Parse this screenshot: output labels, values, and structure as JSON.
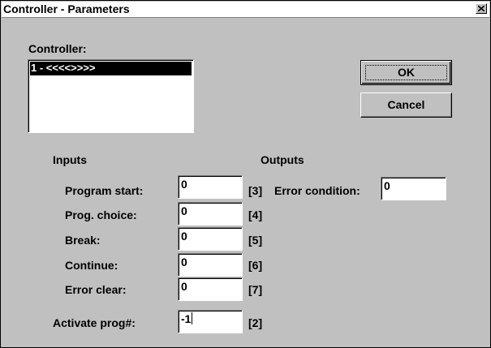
{
  "window": {
    "title": "Controller - Parameters",
    "close_icon": "close-icon"
  },
  "controller": {
    "label": "Controller:",
    "items": [
      "1 - <<<<>>>>"
    ],
    "selected_index": 0
  },
  "buttons": {
    "ok_label": "OK",
    "cancel_label": "Cancel"
  },
  "inputs": {
    "heading": "Inputs",
    "fields": [
      {
        "label": "Program start:",
        "value": "0",
        "index": "[3]"
      },
      {
        "label": "Prog. choice:",
        "value": "0",
        "index": "[4]"
      },
      {
        "label": "Break:",
        "value": "0",
        "index": "[5]"
      },
      {
        "label": "Continue:",
        "value": "0",
        "index": "[6]"
      },
      {
        "label": "Error clear:",
        "value": "0",
        "index": "[7]"
      }
    ]
  },
  "outputs": {
    "heading": "Outputs",
    "error_condition_label": "Error condition:",
    "error_condition_value": "0"
  },
  "activate": {
    "label": "Activate prog#:",
    "value": "-1",
    "index": "[2]"
  }
}
